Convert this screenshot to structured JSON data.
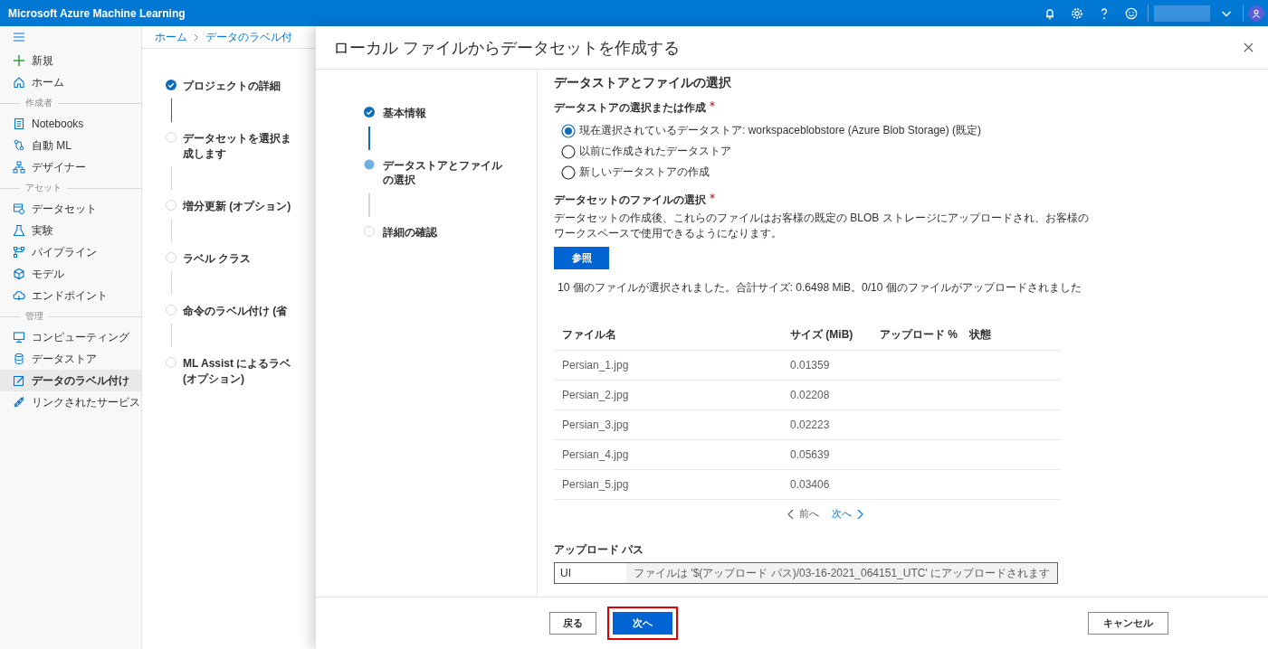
{
  "topbar": {
    "title": "Microsoft Azure Machine Learning"
  },
  "sidebar": {
    "items": [
      {
        "kind": "item",
        "label": "新規",
        "selected": false
      },
      {
        "kind": "item",
        "label": "ホーム",
        "selected": false
      },
      {
        "kind": "header",
        "label": "作成者"
      },
      {
        "kind": "item",
        "label": "Notebooks",
        "selected": false
      },
      {
        "kind": "item",
        "label": "自動 ML",
        "selected": false
      },
      {
        "kind": "item",
        "label": "デザイナー",
        "selected": false
      },
      {
        "kind": "header",
        "label": "アセット"
      },
      {
        "kind": "item",
        "label": "データセット",
        "selected": false
      },
      {
        "kind": "item",
        "label": "実験",
        "selected": false
      },
      {
        "kind": "item",
        "label": "パイプライン",
        "selected": false
      },
      {
        "kind": "item",
        "label": "モデル",
        "selected": false
      },
      {
        "kind": "item",
        "label": "エンドポイント",
        "selected": false
      },
      {
        "kind": "header",
        "label": "管理"
      },
      {
        "kind": "item",
        "label": "コンピューティング",
        "selected": false
      },
      {
        "kind": "item",
        "label": "データストア",
        "selected": false
      },
      {
        "kind": "item",
        "label": "データのラベル付け",
        "selected": true
      },
      {
        "kind": "item",
        "label": "リンクされたサービス",
        "selected": false
      }
    ]
  },
  "background_page": {
    "breadcrumb": [
      "ホーム",
      "データのラベル付"
    ],
    "steps": [
      {
        "label": "プロジェクトの詳細",
        "completed": true,
        "current": false
      },
      {
        "lines": [
          "データセットを選択ま",
          "成します"
        ],
        "completed": false,
        "current": false
      },
      {
        "label": "増分更新 (オプション)",
        "completed": false,
        "current": false
      },
      {
        "label": "ラベル クラス",
        "completed": false,
        "current": false
      },
      {
        "label": "命令のラベル付け (省",
        "completed": false,
        "current": false
      },
      {
        "lines": [
          "ML Assist によるラベ",
          "(オプション)"
        ],
        "completed": false,
        "current": false
      }
    ]
  },
  "dialog": {
    "title": "ローカル ファイルからデータセットを作成する",
    "steps": [
      {
        "label": "基本情報",
        "completed": true,
        "current": false
      },
      {
        "label": "データストアとファイルの選択",
        "completed": false,
        "current": true
      },
      {
        "label": "詳細の確認",
        "completed": false,
        "current": false
      }
    ],
    "heading": "データストアとファイルの選択",
    "datastore_label": "データストアの選択または作成",
    "datastore_required": true,
    "datastore_options": [
      {
        "label": "現在選択されているデータストア: workspaceblobstore (Azure Blob Storage) (既定)",
        "selected": true
      },
      {
        "label": "以前に作成されたデータストア",
        "selected": false
      },
      {
        "label": "新しいデータストアの作成",
        "selected": false
      }
    ],
    "files_label": "データセットのファイルの選択",
    "files_required": true,
    "files_description": "データセットの作成後、これらのファイルはお客様の既定の BLOB ストレージにアップロードされ、お客様のワークスペースで使用できるようになります。",
    "browse_button": "参照",
    "summary": "10 個のファイルが選択されました。合計サイズ: 0.6498 MiB。0/10 個のファイルがアップロードされました",
    "table": {
      "columns": [
        "ファイル名",
        "サイズ (MiB)",
        "アップロード %",
        "状態"
      ],
      "rows": [
        [
          "Persian_1.jpg",
          "0.01359"
        ],
        [
          "Persian_2.jpg",
          "0.02208"
        ],
        [
          "Persian_3.jpg",
          "0.02223"
        ],
        [
          "Persian_4.jpg",
          "0.05639"
        ],
        [
          "Persian_5.jpg",
          "0.03406"
        ]
      ]
    },
    "pagination": {
      "previous": {
        "label": "前へ",
        "disabled": true
      },
      "next": {
        "label": "次へ",
        "disabled": false
      }
    },
    "upload_path": {
      "label": "アップロード パス",
      "value": "UI",
      "suffix": "ファイルは '$(アップロード パス)/03-16-2021_064151_UTC' にアップロードされます"
    },
    "footer": {
      "back": "戻る",
      "next": {
        "label": "次へ",
        "highlighted": true
      },
      "cancel": "キャンセル"
    }
  }
}
